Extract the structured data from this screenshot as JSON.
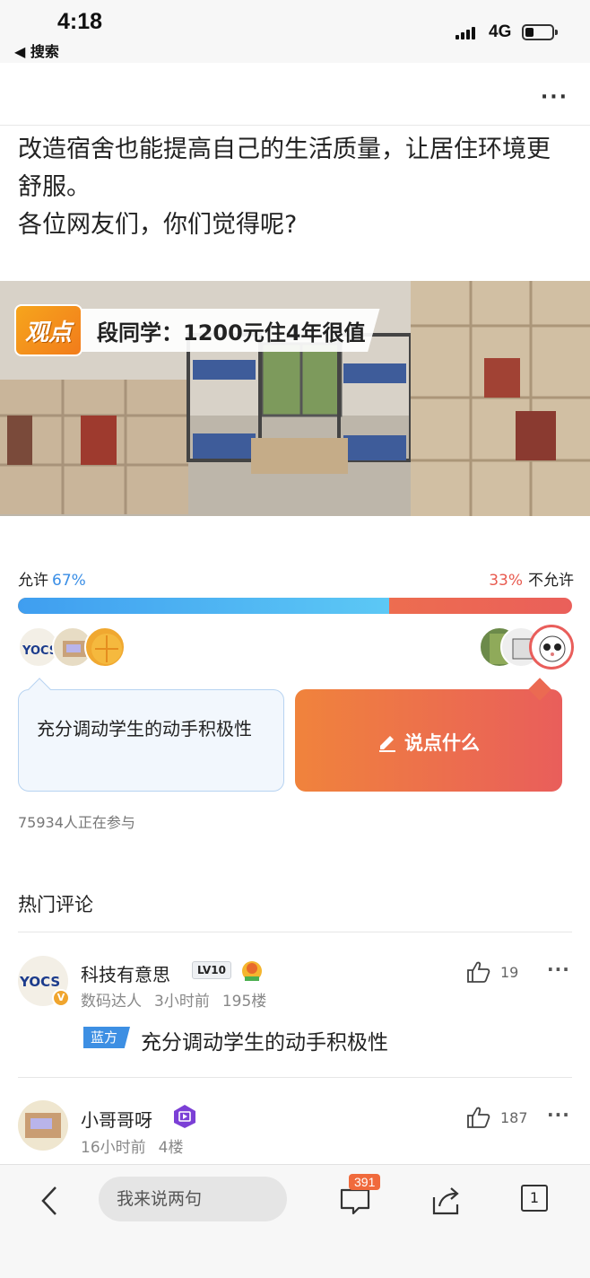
{
  "status_bar": {
    "time": "4:18",
    "back_label": "◀ 搜索",
    "network": "4G"
  },
  "nav": {
    "more": "···"
  },
  "question": {
    "lines": [
      "改造宿舍也能提高自己的生活质量，让居住环境更舒服。",
      "各位网友们，你们觉得呢?"
    ]
  },
  "banner": {
    "badge": "观点",
    "caption": "段同学：1200元住4年很值"
  },
  "vote": {
    "left_label": "允许",
    "left_pct": "67%",
    "right_pct": "33%",
    "right_label": "不允许",
    "left_fraction": 0.67,
    "left_option_text": "充分调动学生的动手积极性",
    "right_action_text": "说点什么",
    "participants": "75934人正在参与"
  },
  "hot_comments": {
    "title": "热门评论",
    "items": [
      {
        "name": "科技有意思",
        "level": "LV10",
        "tag": "数码达人",
        "time": "3小时前",
        "floor": "195楼",
        "likes": "19",
        "stance": "蓝方",
        "text": "充分调动学生的动手积极性"
      },
      {
        "name": "小哥哥呀",
        "time": "16小时前",
        "floor": "4楼",
        "likes": "187"
      }
    ]
  },
  "bottom_bar": {
    "input_placeholder": "我来说两句",
    "comment_count": "391",
    "page_count": "1"
  },
  "colors": {
    "accent_blue": "#3a8ee6",
    "accent_orange": "#f0833c",
    "accent_red": "#e95e5b"
  }
}
